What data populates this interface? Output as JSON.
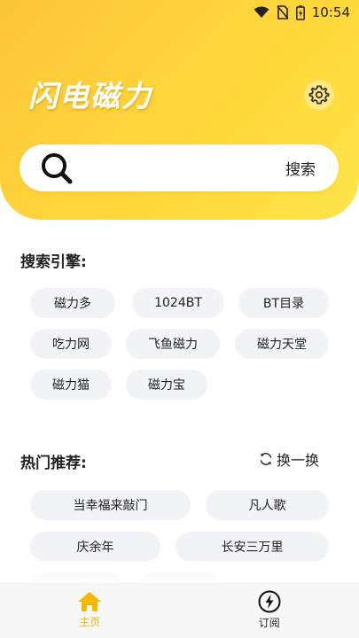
{
  "colors": {
    "accent": "#ffd83b",
    "active_tab": "#f5b800",
    "chip_bg": "#f1f3f7"
  },
  "status_bar": {
    "time": "10:54",
    "icons": [
      "wifi-icon",
      "no-sim-icon",
      "battery-charging-icon"
    ]
  },
  "header": {
    "app_title": "闪电磁力",
    "settings_icon": "gear-icon"
  },
  "search": {
    "value": "",
    "placeholder": "",
    "button_label": "搜索",
    "icon": "search-icon"
  },
  "engines": {
    "title": "搜索引擎:",
    "items": [
      "磁力多",
      "1024BT",
      "BT目录",
      "吃力网",
      "飞鱼磁力",
      "磁力天堂",
      "磁力猫",
      "磁力宝"
    ]
  },
  "hot": {
    "title": "热门推荐:",
    "refresh_label": "换一换",
    "refresh_icon": "refresh-icon",
    "items": [
      "当幸福来敲门",
      "凡人歌",
      "庆余年",
      "长安三万里",
      "",
      ""
    ]
  },
  "tabbar": {
    "tabs": [
      {
        "label": "主页",
        "icon": "home-icon",
        "active": true
      },
      {
        "label": "订阅",
        "icon": "lightning-icon",
        "active": false
      }
    ]
  }
}
